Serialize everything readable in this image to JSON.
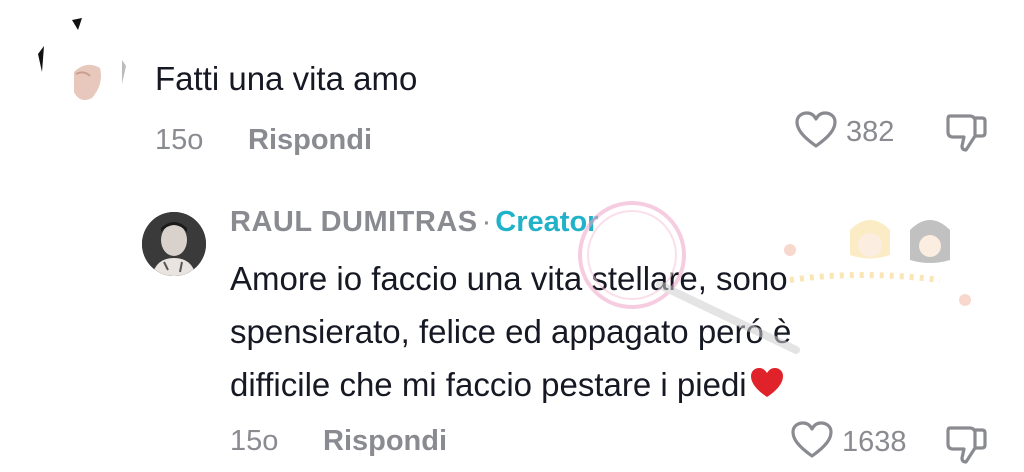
{
  "comment": {
    "text": "Fatti una vita amo",
    "time": "15o",
    "reply_label": "Rispondi",
    "likes": "382"
  },
  "reply": {
    "author": "RAUL DUMITRAS",
    "separator": "·",
    "badge": "Creator",
    "text_lines": [
      "Amore io faccio una vita stellare, sono",
      "spensierato, felice ed appagato peró è",
      "difficile che mi faccio pestare i piedi"
    ],
    "time": "15o",
    "reply_label": "Rispondi",
    "likes": "1638"
  },
  "icons": {
    "like": "heart-outline-icon",
    "dislike": "thumbs-down-icon",
    "emoji": "red-heart-emoji"
  },
  "colors": {
    "text": "#161823",
    "muted": "#8a8b91",
    "creator": "#20b2c8",
    "heart_emoji": "#e0222b"
  }
}
